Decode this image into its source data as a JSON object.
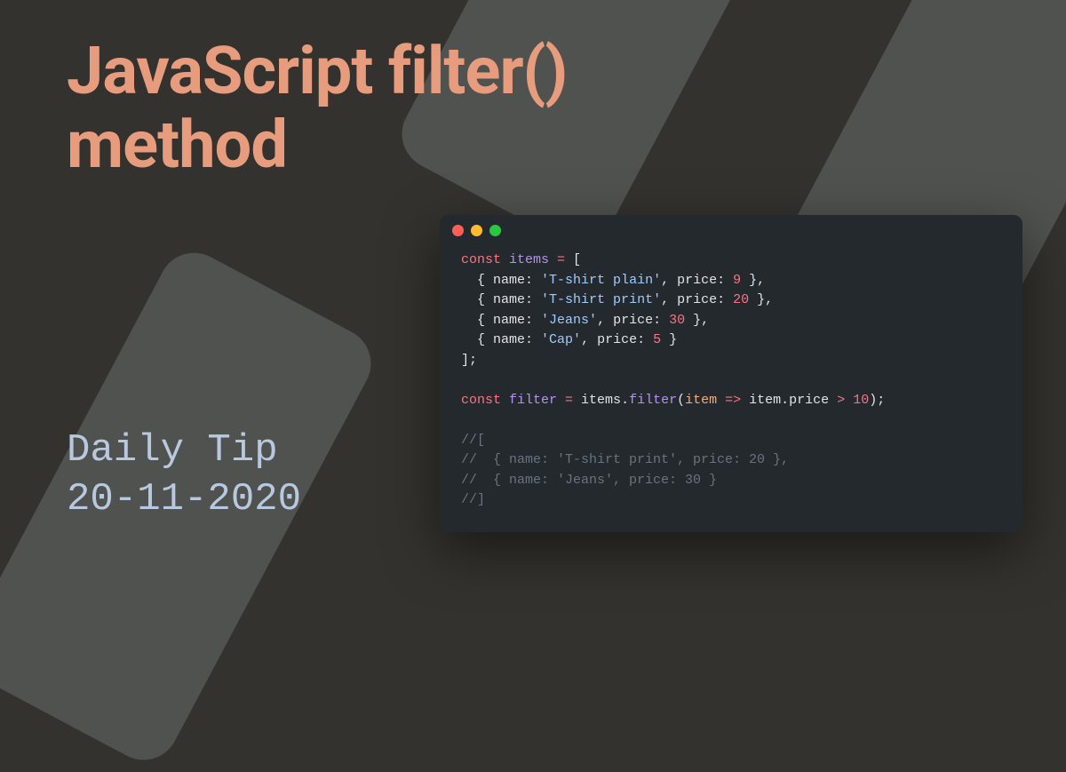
{
  "title": "JavaScript filter() method",
  "subtitle_line1": "Daily Tip",
  "subtitle_line2": "20-11-2020",
  "code": {
    "l1_kw": "const",
    "l1_var": " items ",
    "l1_eq": "= ",
    "l1_brace": "[",
    "l2_open": "  { ",
    "l2_name": "name",
    "l2_colon1": ": ",
    "l2_str": "'T-shirt plain'",
    "l2_comma1": ", ",
    "l2_price": "price",
    "l2_colon2": ": ",
    "l2_num": "9",
    "l2_close": " },",
    "l3_open": "  { ",
    "l3_name": "name",
    "l3_colon1": ": ",
    "l3_str": "'T-shirt print'",
    "l3_comma1": ", ",
    "l3_price": "price",
    "l3_colon2": ": ",
    "l3_num": "20",
    "l3_close": " },",
    "l4_open": "  { ",
    "l4_name": "name",
    "l4_colon1": ": ",
    "l4_str": "'Jeans'",
    "l4_comma1": ", ",
    "l4_price": "price",
    "l4_colon2": ": ",
    "l4_num": "30",
    "l4_close": " },",
    "l5_open": "  { ",
    "l5_name": "name",
    "l5_colon1": ": ",
    "l5_str": "'Cap'",
    "l5_comma1": ", ",
    "l5_price": "price",
    "l5_colon2": ": ",
    "l5_num": "5",
    "l5_close": " }",
    "l6": "];",
    "l7_empty": "",
    "l8_kw": "const",
    "l8_var": " filter ",
    "l8_eq": "= ",
    "l8_items": "items",
    "l8_dot1": ".",
    "l8_fn": "filter",
    "l8_paren1": "(",
    "l8_param": "item",
    "l8_arrow": " => ",
    "l8_item2": "item",
    "l8_dot2": ".",
    "l8_price": "price",
    "l8_gt": " > ",
    "l8_num": "10",
    "l8_paren2": ");",
    "l9_empty": "",
    "c1": "//[",
    "c2": "//  { name: 'T-shirt print', price: 20 },",
    "c3": "//  { name: 'Jeans', price: 30 }",
    "c4": "//]"
  }
}
